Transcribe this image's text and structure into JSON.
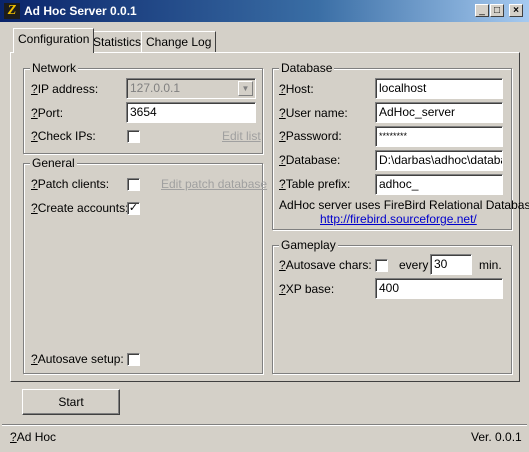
{
  "window": {
    "title": "Ad Hoc Server 0.0.1",
    "icon": "adhoc-app-icon",
    "buttons": {
      "minimize": "_",
      "maximize": "□",
      "close": "×"
    }
  },
  "tabs": [
    "Configuration",
    "Statistics",
    "Change Log"
  ],
  "active_tab": "Configuration",
  "help_marker": "?",
  "network": {
    "title": "Network",
    "ip_label": "IP address:",
    "ip_value": "127.0.0.1",
    "port_label": "Port:",
    "port_value": "3654",
    "check_ips_label": "Check IPs:",
    "check_ips_checked": false,
    "edit_list_label": "Edit list"
  },
  "general": {
    "title": "General",
    "patch_clients_label": "Patch clients:",
    "patch_clients_checked": false,
    "edit_patch_label": "Edit patch database",
    "create_accounts_label": "Create accounts:",
    "create_accounts_mark": "✓",
    "autosave_setup_label": "Autosave setup:",
    "autosave_setup_checked": false
  },
  "database": {
    "title": "Database",
    "host_label": "Host:",
    "host_value": "localhost",
    "user_label": "User name:",
    "user_value": "AdHoc_server",
    "password_label": "Password:",
    "password_value": "********",
    "database_label": "Database:",
    "database_value": "D:\\darbas\\adhoc\\databa",
    "prefix_label": "Table prefix:",
    "prefix_value": "adhoc_",
    "note": "AdHoc server uses FireBird Relational Database",
    "link": "http://firebird.sourceforge.net/"
  },
  "gameplay": {
    "title": "Gameplay",
    "autosave_label": "Autosave chars:",
    "autosave_checked": false,
    "every_label": "every",
    "every_value": "30",
    "min_label": "min.",
    "xp_label": "XP base:",
    "xp_value": "400"
  },
  "start_button": "Start",
  "footer": {
    "left_label": "Ad Hoc",
    "version": "Ver. 0.0.1"
  },
  "colors": {
    "face": "#d4d0c8",
    "title_start": "#0a246a",
    "title_end": "#a6caf0",
    "link": "#0000cc"
  }
}
